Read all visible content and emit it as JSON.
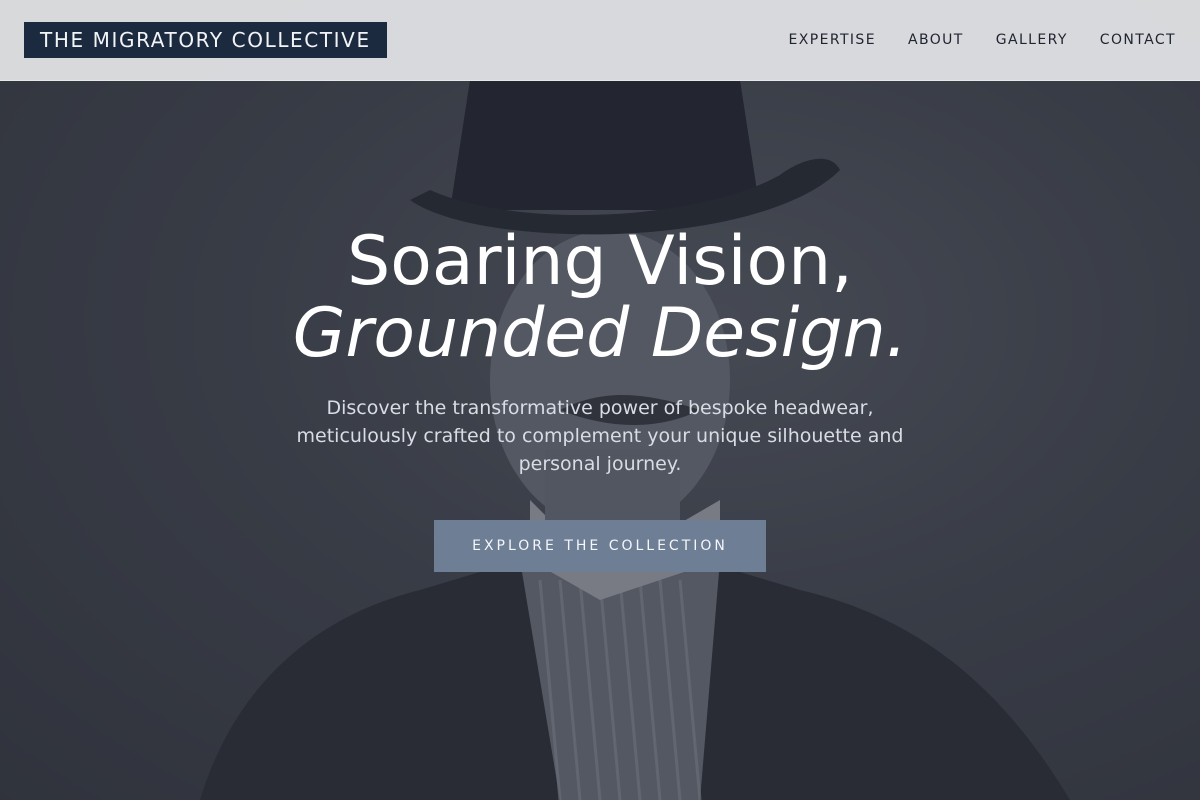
{
  "header": {
    "brand": "THE MIGRATORY COLLECTIVE",
    "nav": [
      {
        "label": "EXPERTISE"
      },
      {
        "label": "ABOUT"
      },
      {
        "label": "GALLERY"
      },
      {
        "label": "CONTACT"
      }
    ]
  },
  "hero": {
    "headline_line1": "Soaring Vision,",
    "headline_line2": "Grounded Design.",
    "subtext": "Discover the transformative power of bespoke headwear, meticulously crafted to complement your unique silhouette and personal journey.",
    "cta_label": "EXPLORE THE COLLECTION",
    "background_image": "vintage portrait of a man in a top hat"
  },
  "colors": {
    "brand_bg": "#1c2a40",
    "cta_bg": "#6d7e95",
    "nav_bg": "#e4e5e7"
  }
}
